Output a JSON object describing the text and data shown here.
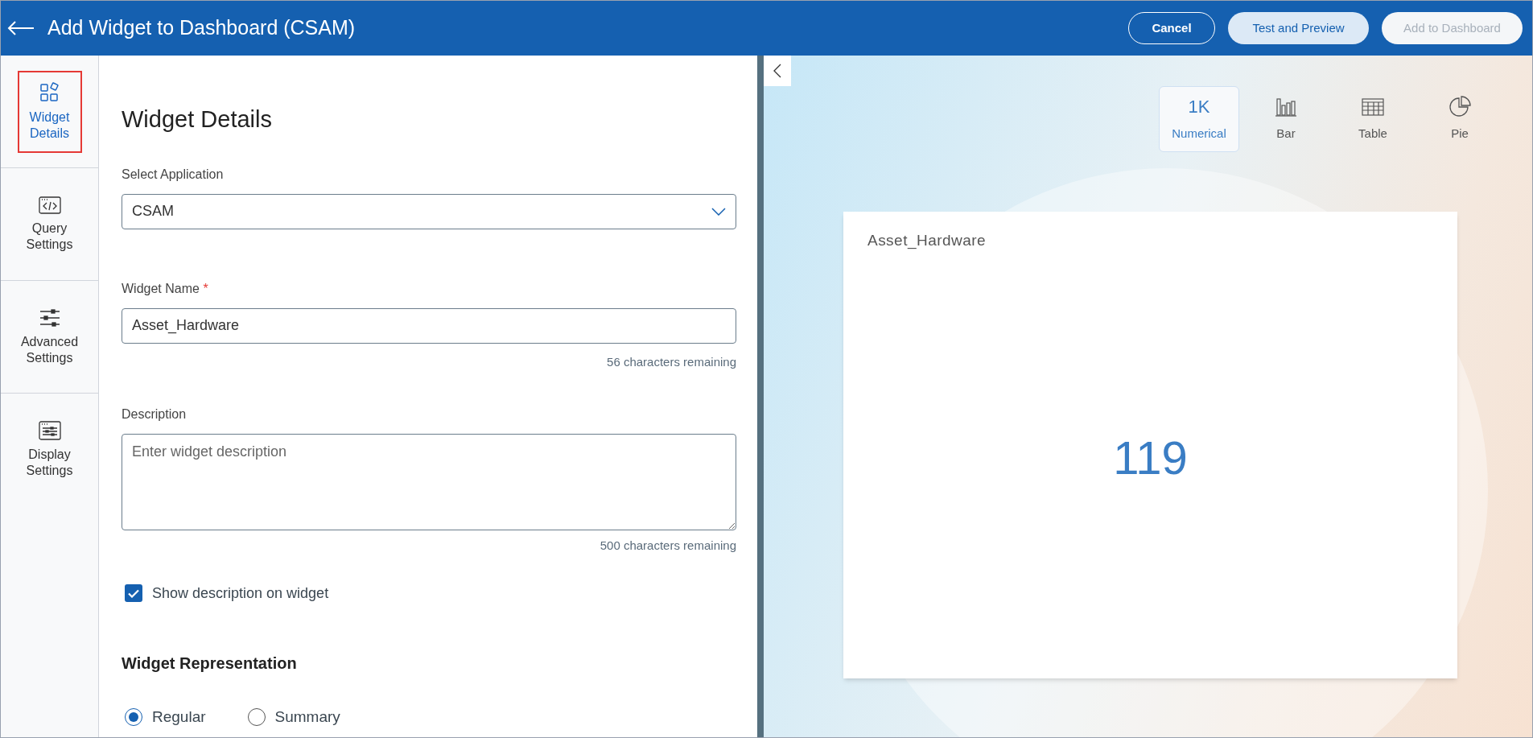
{
  "header": {
    "title": "Add Widget to Dashboard (CSAM)",
    "buttons": [
      {
        "label": "Cancel",
        "kind": "outline",
        "disabled": false
      },
      {
        "label": "Test and Preview",
        "kind": "light",
        "disabled": false
      },
      {
        "label": "Add to Dashboard",
        "kind": "light",
        "disabled": true
      }
    ]
  },
  "sidebar": {
    "items": [
      {
        "label": "Widget Details",
        "selected": true
      },
      {
        "label": "Query Settings",
        "selected": false
      },
      {
        "label": "Advanced Settings",
        "selected": false
      },
      {
        "label": "Display Settings",
        "selected": false
      }
    ]
  },
  "form": {
    "title": "Widget Details",
    "application": {
      "label": "Select Application",
      "value": "CSAM"
    },
    "widget_name": {
      "label": "Widget Name",
      "required_mark": "*",
      "value": "Asset_Hardware",
      "hint": "56 characters remaining"
    },
    "description": {
      "label": "Description",
      "placeholder": "Enter widget description",
      "hint": "500 characters remaining"
    },
    "show_description": {
      "label": "Show description on widget",
      "checked": true
    },
    "representation": {
      "title": "Widget Representation",
      "options": [
        {
          "label": "Regular",
          "selected": true
        },
        {
          "label": "Summary",
          "selected": false
        }
      ]
    }
  },
  "preview": {
    "chart_types": [
      {
        "label": "Numerical",
        "icon_text": "1K",
        "selected": true
      },
      {
        "label": "Bar",
        "selected": false
      },
      {
        "label": "Table",
        "selected": false
      },
      {
        "label": "Pie",
        "selected": false
      }
    ],
    "widget": {
      "title": "Asset_Hardware",
      "value": "119"
    }
  }
}
